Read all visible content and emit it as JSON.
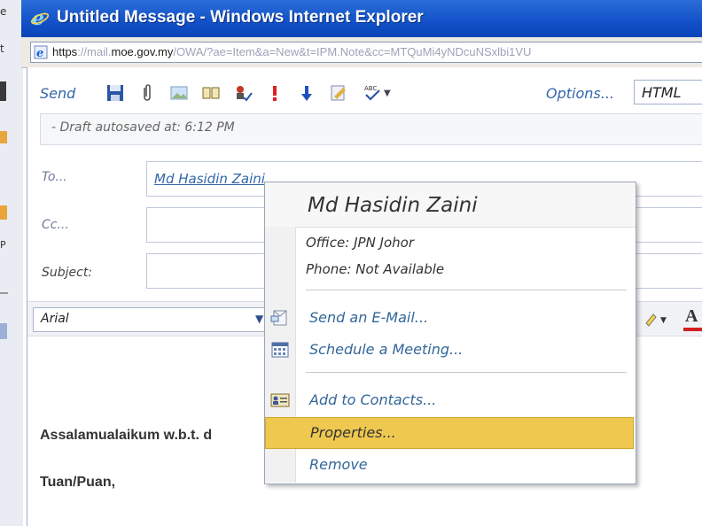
{
  "window": {
    "title": "Untitled Message - Windows Internet Explorer"
  },
  "address": {
    "scheme": "https",
    "sep": "://mail.",
    "host": "moe.gov.my",
    "rest": "/OWA/?ae=Item&a=New&t=IPM.Note&cc=MTQuMi4yNDcuNSxlbi1VU"
  },
  "toolbar": {
    "send_label": "Send",
    "options_label": "Options...",
    "format_value": "HTML"
  },
  "draft": {
    "status": "- Draft autosaved at: 6:12 PM"
  },
  "fields": {
    "to_label": "To...",
    "to_value": "Md Hasidin Zaini",
    "cc_label": "Cc...",
    "subject_label": "Subject:"
  },
  "format": {
    "font_name": "Arial",
    "color_letter": "A"
  },
  "body": {
    "line1": "Assalamualaikum w.b.t. d",
    "line2": "Tuan/Puan,"
  },
  "menu": {
    "name": "Md Hasidin Zaini",
    "office": "Office: JPN Johor",
    "phone": "Phone: Not Available",
    "items": [
      {
        "label": "Send an E-Mail...",
        "icon": "envelope-icon"
      },
      {
        "label": "Schedule a Meeting...",
        "icon": "calendar-icon"
      },
      {
        "label": "Add to Contacts...",
        "icon": "contact-card-icon"
      },
      {
        "label": "Properties...",
        "icon": ""
      },
      {
        "label": "Remove",
        "icon": ""
      }
    ],
    "highlight_color": "#efc850"
  },
  "colors": {
    "titlebar": "#1150c8",
    "link": "#3366aa",
    "font_color_underline": "#d32020"
  }
}
